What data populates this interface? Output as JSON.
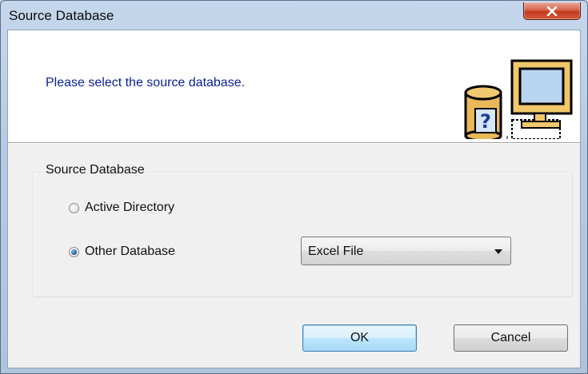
{
  "window": {
    "title": "Source Database",
    "close_icon": "close-x-icon"
  },
  "header": {
    "text": "Please select the source database.",
    "icon": "database-computer-question-icon"
  },
  "group": {
    "legend": "Source Database",
    "options": [
      {
        "label": "Active Directory",
        "checked": false
      },
      {
        "label": "Other Database",
        "checked": true
      }
    ],
    "database_type": {
      "selected": "Excel File"
    }
  },
  "buttons": {
    "ok": "OK",
    "cancel": "Cancel"
  },
  "colors": {
    "header_text": "#0a1f96",
    "close_button": "#c23a1e",
    "dialog_background": "#f0f0f0"
  }
}
